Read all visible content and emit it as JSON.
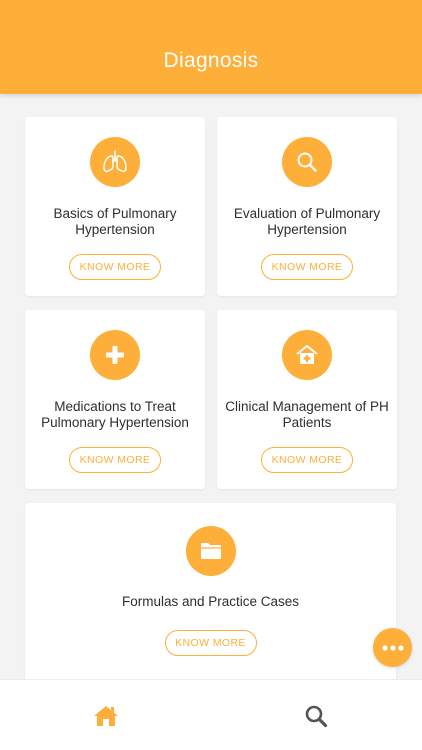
{
  "header": {
    "title": "Diagnosis"
  },
  "cards": [
    {
      "icon": "lungs-icon",
      "title": "Basics of Pulmonary Hypertension",
      "button_label": "KNOW MORE"
    },
    {
      "icon": "search-icon",
      "title": "Evaluation of Pulmonary Hypertension",
      "button_label": "KNOW MORE"
    },
    {
      "icon": "plus-icon",
      "title": "Medications to Treat Pulmonary Hypertension",
      "button_label": "KNOW MORE"
    },
    {
      "icon": "hospital-icon",
      "title": "Clinical Management of PH Patients",
      "button_label": "KNOW MORE"
    },
    {
      "icon": "folder-icon",
      "title": "Formulas and Practice Cases",
      "button_label": "KNOW MORE"
    }
  ],
  "fab": {
    "icon": "more-dots-icon"
  },
  "bottom_nav": [
    {
      "icon": "home-icon",
      "active": true
    },
    {
      "icon": "search-icon",
      "active": false
    }
  ],
  "colors": {
    "accent": "#fdaf3a",
    "background": "#f3f3f3",
    "nav_inactive": "#555555"
  }
}
